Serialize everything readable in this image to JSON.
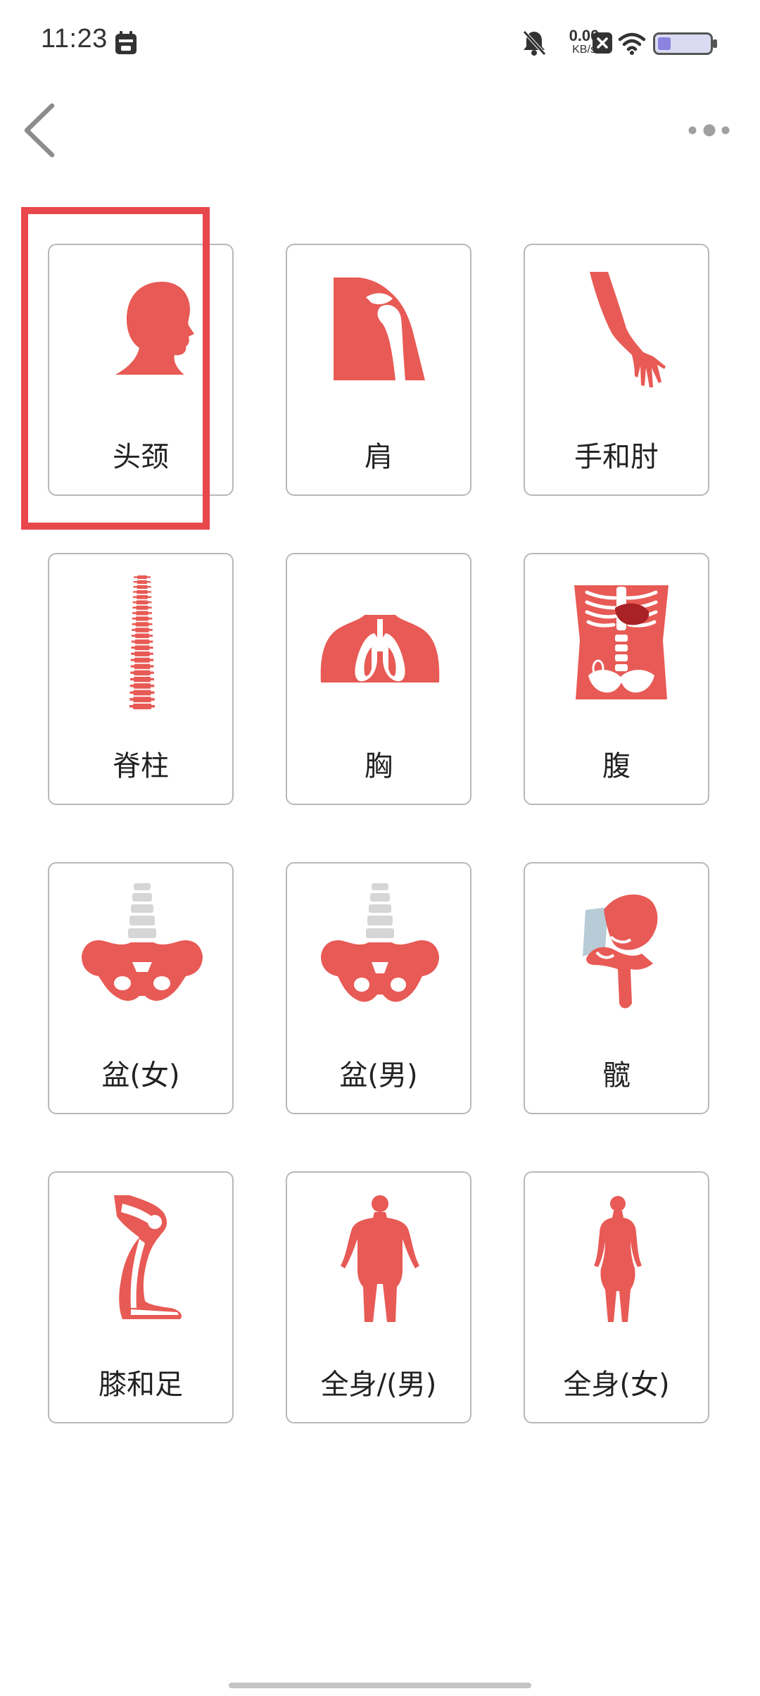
{
  "status_bar": {
    "time": "11:23",
    "net_speed_value": "0.00",
    "net_speed_unit": "KB/s",
    "icons": [
      "calendar-icon",
      "bell-mute-icon",
      "net-speed",
      "close-box-icon",
      "wifi-icon",
      "battery-icon"
    ]
  },
  "nav": {
    "back_icon": "chevron-left-icon",
    "more_icon": "more-dots-icon"
  },
  "colors": {
    "accent": "#e8474b",
    "illustration": "#e85a55",
    "card_border": "#b8b8b8",
    "text": "#222222"
  },
  "body_parts": [
    {
      "label": "头颈",
      "icon": "head-neck-icon",
      "selected": true
    },
    {
      "label": "肩",
      "icon": "shoulder-icon",
      "selected": false
    },
    {
      "label": "手和肘",
      "icon": "arm-hand-icon",
      "selected": false
    },
    {
      "label": "脊柱",
      "icon": "spine-icon",
      "selected": false
    },
    {
      "label": "胸",
      "icon": "chest-lungs-icon",
      "selected": false
    },
    {
      "label": "腹",
      "icon": "abdomen-icon",
      "selected": false
    },
    {
      "label": "盆(女)",
      "icon": "pelvis-female-icon",
      "selected": false
    },
    {
      "label": "盆(男)",
      "icon": "pelvis-male-icon",
      "selected": false
    },
    {
      "label": "髋",
      "icon": "hip-icon",
      "selected": false
    },
    {
      "label": "膝和足",
      "icon": "knee-foot-icon",
      "selected": false
    },
    {
      "label": "全身/(男)",
      "icon": "full-body-male-icon",
      "selected": false
    },
    {
      "label": "全身(女)",
      "icon": "full-body-female-icon",
      "selected": false
    }
  ]
}
